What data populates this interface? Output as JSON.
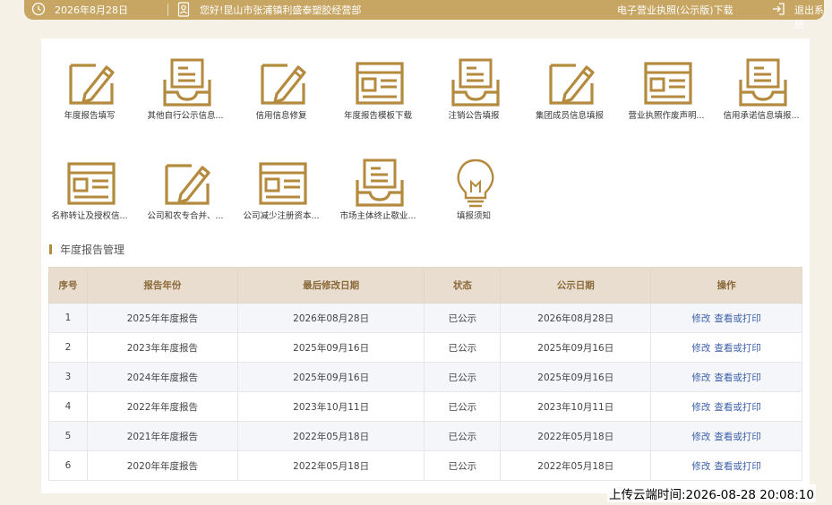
{
  "colors": {
    "accent": "#c7a664",
    "icon": "#b48a3e",
    "link": "#3a5fa8",
    "header_bg": "#e9ddd0"
  },
  "topbar": {
    "date": "2026年8月28日",
    "greeting": "您好!昆山市张浦镇利盛泰塑胶经营部",
    "license_link": "电子营业执照(公示版)下载",
    "logout": "退出系统",
    "icons": [
      "clock-icon",
      "user-icon",
      "logout-icon"
    ]
  },
  "tiles": [
    {
      "label": "年度报告填写",
      "icon": "pencil-edit-icon"
    },
    {
      "label": "其他自行公示信息...",
      "icon": "inbox-tray-icon"
    },
    {
      "label": "信用信息修复",
      "icon": "pencil-edit-icon"
    },
    {
      "label": "年度报告模板下载",
      "icon": "form-window-icon"
    },
    {
      "label": "注销公告填报",
      "icon": "inbox-tray-icon"
    },
    {
      "label": "集团成员信息填报",
      "icon": "pencil-edit-icon"
    },
    {
      "label": "营业执照作废声明...",
      "icon": "form-window-icon"
    },
    {
      "label": "信用承诺信息填报...",
      "icon": "inbox-tray-icon"
    },
    {
      "label": "名称转让及授权信...",
      "icon": "form-window-icon"
    },
    {
      "label": "公司和农专合并、...",
      "icon": "pencil-edit-icon"
    },
    {
      "label": "公司减少注册资本...",
      "icon": "form-window-icon"
    },
    {
      "label": "市场主体终止歇业...",
      "icon": "inbox-tray-icon"
    },
    {
      "label": "填报须知",
      "icon": "lightbulb-icon"
    }
  ],
  "section_title": "年度报告管理",
  "table": {
    "headers": [
      "序号",
      "报告年份",
      "最后修改日期",
      "状态",
      "公示日期",
      "操作"
    ],
    "rows": [
      {
        "no": "1",
        "year": "2025年年度报告",
        "modified": "2026年08月28日",
        "status": "已公示",
        "published": "2026年08月28日",
        "edit": "修改",
        "view": "查看或打印"
      },
      {
        "no": "2",
        "year": "2023年年度报告",
        "modified": "2025年09月16日",
        "status": "已公示",
        "published": "2025年09月16日",
        "edit": "修改",
        "view": "查看或打印"
      },
      {
        "no": "3",
        "year": "2024年年度报告",
        "modified": "2025年09月16日",
        "status": "已公示",
        "published": "2025年09月16日",
        "edit": "修改",
        "view": "查看或打印"
      },
      {
        "no": "4",
        "year": "2022年年度报告",
        "modified": "2023年10月11日",
        "status": "已公示",
        "published": "2023年10月11日",
        "edit": "修改",
        "view": "查看或打印"
      },
      {
        "no": "5",
        "year": "2021年年度报告",
        "modified": "2022年05月18日",
        "status": "已公示",
        "published": "2022年05月18日",
        "edit": "修改",
        "view": "查看或打印"
      },
      {
        "no": "6",
        "year": "2020年年度报告",
        "modified": "2022年05月18日",
        "status": "已公示",
        "published": "2022年05月18日",
        "edit": "修改",
        "view": "查看或打印"
      }
    ]
  },
  "upload_time": "上传云端时间:2026-08-28 20:08:10"
}
